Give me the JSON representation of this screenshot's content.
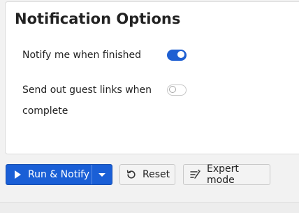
{
  "panel": {
    "title": "Notification Options"
  },
  "options": [
    {
      "label": "Notify me when finished",
      "enabled": true
    },
    {
      "label": "Send out guest links when complete",
      "enabled": false
    }
  ],
  "toolbar": {
    "run_label": "Run & Notify",
    "reset_label": "Reset",
    "expert_label": "Expert mode"
  },
  "colors": {
    "primary": "#1a5fd6",
    "toggle_on": "#1e5fd2"
  },
  "icons": {
    "run": "play-icon",
    "dropdown": "chevron-down-icon",
    "reset": "reset-icon",
    "expert": "expert-mode-icon"
  }
}
